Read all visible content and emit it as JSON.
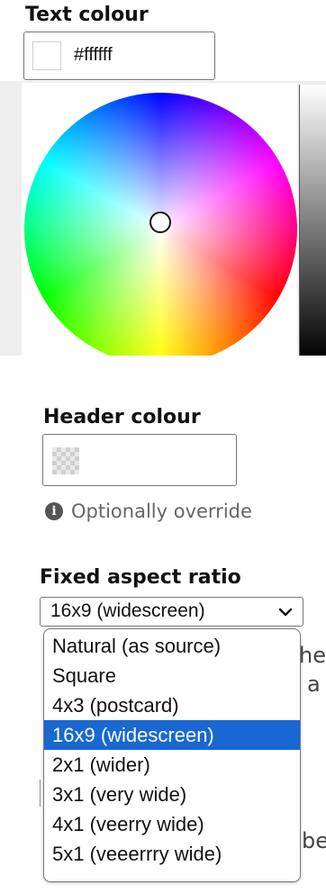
{
  "text_colour": {
    "label": "Text colour",
    "value": "#ffffff",
    "swatch_color": "#ffffff"
  },
  "header_colour": {
    "label": "Header colour",
    "hint": "Optionally override",
    "info_icon": "i"
  },
  "aspect_ratio": {
    "label": "Fixed aspect ratio",
    "selected": "16x9 (widescreen)",
    "options": [
      "Natural (as source)",
      "Square",
      "4x3 (postcard)",
      "16x9 (widescreen)",
      "2x1 (wider)",
      "3x1 (very wide)",
      "4x1 (veerry wide)",
      "5x1 (veeerrry wide)"
    ],
    "selected_index": 3
  },
  "behind": {
    "fragment_1": "he",
    "fragment_2": "a",
    "fragment_3": "be"
  },
  "colors": {
    "selection_blue": "#1967d2",
    "hint_gray": "#666666"
  },
  "icons": [
    "wheel-cursor-icon",
    "info-icon",
    "chevron-down-icon",
    "checkerboard-transparent-icon"
  ]
}
